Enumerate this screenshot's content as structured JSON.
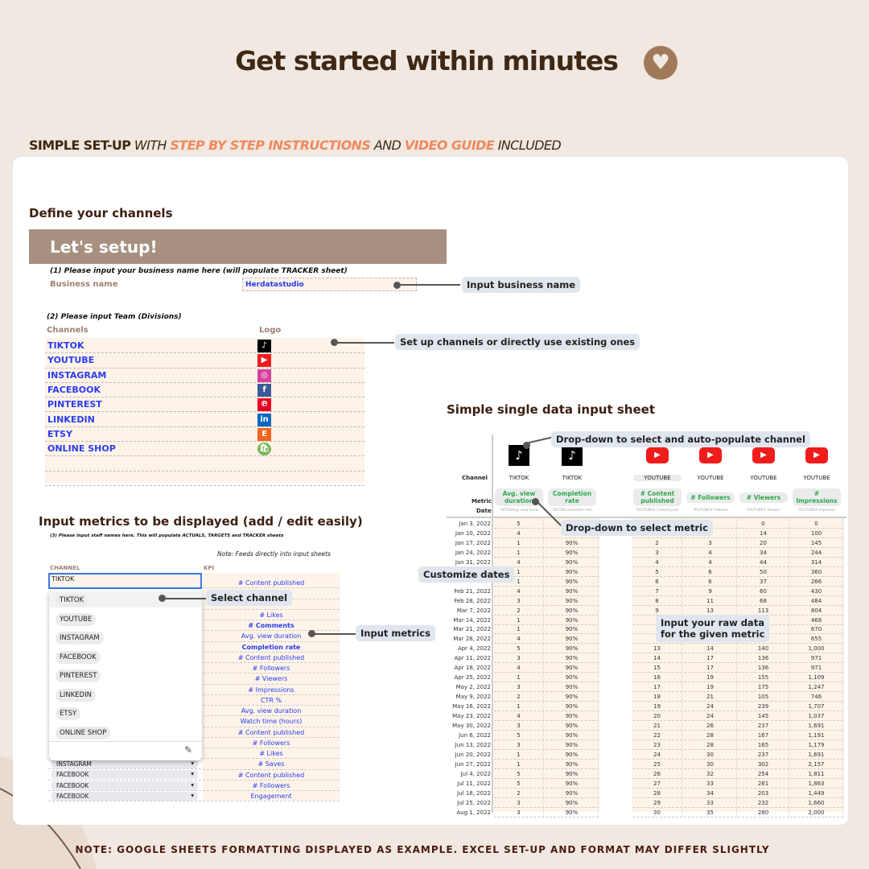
{
  "header": {
    "title": "Get started within minutes",
    "icon": "heart-icon"
  },
  "subtitle": {
    "p1": "SIMPLE SET-UP",
    "p2": " WITH ",
    "p3": "STEP BY STEP INSTRUCTIONS",
    "p4": " AND ",
    "p5": "VIDEO GUIDE",
    "p6": " INCLUDED"
  },
  "setup": {
    "section_title": "Define your channels",
    "banner": "Let's setup!",
    "step1": "(1) Please input your business name here (will populate TRACKER sheet)",
    "business_label": "Business name",
    "business_value": "Herdatastudio",
    "step2": "(2) Please input Team (Divisions)",
    "channels_header": "Channels",
    "logo_header": "Logo",
    "channels": [
      {
        "name": "TIKTOK",
        "icon": "tiktok-icon",
        "color": "#000000",
        "glyph": "♪"
      },
      {
        "name": "YOUTUBE",
        "icon": "youtube-icon",
        "color": "#f01c1c",
        "glyph": "▶"
      },
      {
        "name": "INSTAGRAM",
        "icon": "instagram-icon",
        "color": "#d6409f",
        "glyph": "◎"
      },
      {
        "name": "FACEBOOK",
        "icon": "facebook-icon",
        "color": "#3b5998",
        "glyph": "f"
      },
      {
        "name": "PINTEREST",
        "icon": "pinterest-icon",
        "color": "#e60023",
        "glyph": "℗"
      },
      {
        "name": "LINKEDIN",
        "icon": "linkedin-icon",
        "color": "#0a66c2",
        "glyph": "in"
      },
      {
        "name": "ETSY",
        "icon": "etsy-icon",
        "color": "#f1641e",
        "glyph": "E"
      },
      {
        "name": "ONLINE SHOP",
        "icon": "shopify-icon",
        "color": "#7ab55c",
        "glyph": "🛍"
      }
    ]
  },
  "metrics": {
    "section_title": "Input metrics to be displayed (add / edit easily)",
    "step3": "(3) Please input staff names here. This will populate ACTUALS, TARGETS and TRACKER sheets",
    "note": "Note: Feeds directly into input sheets",
    "channel_header": "CHANNEL",
    "kpi_header": "KPI",
    "active_input": "TIKTOK",
    "dropdown_options": [
      "TIKTOK",
      "YOUTUBE",
      "INSTAGRAM",
      "FACEBOOK",
      "PINTEREST",
      "LINKEDIN",
      "ETSY",
      "ONLINE SHOP"
    ],
    "kpis": [
      "# Content published",
      "",
      "",
      "# Likes",
      "# Comments",
      "Avg. view duration",
      "Completion rate",
      "# Content published",
      "# Followers",
      "# Viewers",
      "# Impressions",
      "CTR %",
      "Avg. view duration",
      "Watch time (hours)",
      "# Content published",
      "# Followers",
      "# Likes",
      "# Saves",
      "# Content published",
      "# Followers",
      "Engagement"
    ],
    "visible_channels": [
      "INSTAGRAM",
      "FACEBOOK",
      "FACEBOOK",
      "FACEBOOK"
    ]
  },
  "sheet": {
    "section_title": "Simple single data input sheet",
    "channel_label": "Channel",
    "metric_label": "Metric",
    "date_label": "Date",
    "columns": [
      {
        "channel": "TIKTOK",
        "metric": "Avg. view duration",
        "key": "TIKTOKAvg. view durat",
        "icon": "tiktok-icon"
      },
      {
        "channel": "TIKTOK",
        "metric": "Completion rate",
        "key": "TIKTOKCompletion rate",
        "icon": "tiktok-icon"
      },
      {
        "channel": "YOUTUBE",
        "metric": "# Content published",
        "key": "YOUTUBE# Content publ",
        "icon": "youtube-icon"
      },
      {
        "channel": "YOUTUBE",
        "metric": "# Followers",
        "key": "YOUTUBE# Follower",
        "icon": "youtube-icon"
      },
      {
        "channel": "YOUTUBE",
        "metric": "# Viewers",
        "key": "YOUTUBE# Viewers",
        "icon": "youtube-icon"
      },
      {
        "channel": "YOUTUBE",
        "metric": "# Impressions",
        "key": "YOUTUBE# Impressio",
        "icon": "youtube-icon"
      }
    ],
    "rows": [
      [
        "Jan 3, 2022",
        "5",
        "",
        "",
        "0",
        "0",
        "0"
      ],
      [
        "Jan 10, 2022",
        "4",
        "",
        "",
        "2",
        "14",
        "100"
      ],
      [
        "Jan 17, 2022",
        "1",
        "90%",
        "2",
        "3",
        "20",
        "145"
      ],
      [
        "Jan 24, 2022",
        "1",
        "90%",
        "3",
        "4",
        "34",
        "244"
      ],
      [
        "Jan 31, 2022",
        "4",
        "90%",
        "4",
        "4",
        "44",
        "314"
      ],
      [
        "",
        "1",
        "90%",
        "5",
        "6",
        "50",
        "360"
      ],
      [
        "",
        "1",
        "90%",
        "6",
        "6",
        "37",
        "266"
      ],
      [
        "Feb 21, 2022",
        "4",
        "90%",
        "7",
        "9",
        "60",
        "430"
      ],
      [
        "Feb 28, 2022",
        "3",
        "90%",
        "8",
        "11",
        "68",
        "484"
      ],
      [
        "Mar 7, 2022",
        "2",
        "90%",
        "9",
        "13",
        "113",
        "804"
      ],
      [
        "Mar 14, 2022",
        "1",
        "90%",
        "",
        "",
        "",
        "468"
      ],
      [
        "Mar 21, 2022",
        "1",
        "90%",
        "",
        "",
        "",
        "670"
      ],
      [
        "Mar 28, 2022",
        "4",
        "90%",
        "",
        "",
        "",
        "655"
      ],
      [
        "Apr 4, 2022",
        "5",
        "90%",
        "13",
        "14",
        "140",
        "1,000"
      ],
      [
        "Apr 11, 2022",
        "3",
        "90%",
        "14",
        "17",
        "136",
        "971"
      ],
      [
        "Apr 18, 2022",
        "4",
        "90%",
        "15",
        "17",
        "136",
        "971"
      ],
      [
        "Apr 25, 2022",
        "1",
        "90%",
        "16",
        "19",
        "155",
        "1,109"
      ],
      [
        "May 2, 2022",
        "3",
        "90%",
        "17",
        "19",
        "175",
        "1,247"
      ],
      [
        "May 9, 2022",
        "2",
        "90%",
        "18",
        "21",
        "105",
        "746"
      ],
      [
        "May 16, 2022",
        "1",
        "90%",
        "19",
        "24",
        "239",
        "1,707"
      ],
      [
        "May 23, 2022",
        "4",
        "90%",
        "20",
        "24",
        "145",
        "1,037"
      ],
      [
        "May 30, 2022",
        "3",
        "90%",
        "21",
        "26",
        "237",
        "1,691"
      ],
      [
        "Jun 6, 2022",
        "5",
        "90%",
        "22",
        "28",
        "167",
        "1,191"
      ],
      [
        "Jun 13, 2022",
        "3",
        "90%",
        "23",
        "28",
        "165",
        "1,179"
      ],
      [
        "Jun 20, 2022",
        "1",
        "90%",
        "24",
        "30",
        "237",
        "1,691"
      ],
      [
        "Jun 27, 2022",
        "1",
        "90%",
        "25",
        "30",
        "302",
        "2,157"
      ],
      [
        "Jul 4, 2022",
        "5",
        "90%",
        "26",
        "32",
        "254",
        "1,811"
      ],
      [
        "Jul 11, 2022",
        "5",
        "90%",
        "27",
        "33",
        "261",
        "1,863"
      ],
      [
        "Jul 18, 2022",
        "2",
        "90%",
        "28",
        "34",
        "203",
        "1,449"
      ],
      [
        "Jul 25, 2022",
        "3",
        "90%",
        "29",
        "33",
        "232",
        "1,660"
      ],
      [
        "Aug 1, 2022",
        "3",
        "90%",
        "30",
        "35",
        "280",
        "2,000"
      ]
    ]
  },
  "callouts": {
    "business": "Input business name",
    "channels": "Set up channels or directly use existing ones",
    "channel_dropdown": "Drop-down to select and auto-populate channel",
    "metric_dropdown": "Drop-down to select metric",
    "dates": "Customize dates",
    "select_channel": "Select channel",
    "input_metrics": "Input metrics",
    "raw_data": "Input your raw data",
    "raw_data2": "for the given metric"
  },
  "footer": {
    "note": "NOTE: GOOGLE SHEETS FORMATTING DISPLAYED AS EXAMPLE. EXCEL SET-UP AND FORMAT MAY DIFFER SLIGHTLY"
  },
  "colors": {
    "brown": "#3f2814",
    "accent": "#ee8a5e",
    "banner": "#a89080",
    "cream": "#fdf3e8",
    "link_blue": "#2a3cf0",
    "metric_green": "#2ea84a"
  }
}
